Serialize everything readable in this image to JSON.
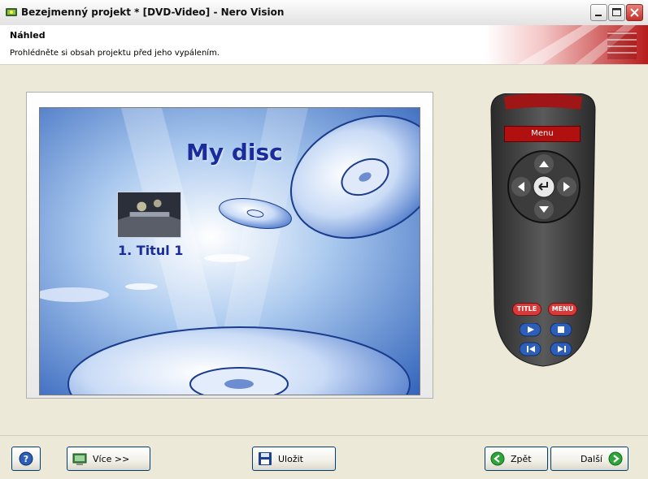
{
  "window": {
    "title": "Bezejmenný projekt * [DVD-Video] - Nero Vision",
    "controls": [
      "minimize-icon",
      "maximize-icon",
      "close-icon"
    ]
  },
  "header": {
    "title": "Náhled",
    "subtitle": "Prohlédněte si obsah projektu před jeho vypálením."
  },
  "preview": {
    "disc_title": "My disc",
    "titles": [
      {
        "label": "1. Titul 1"
      }
    ]
  },
  "remote": {
    "menu_label": "Menu",
    "buttons": {
      "title": "TITLE",
      "menu": "MENU"
    },
    "icons": [
      "up-arrow-icon",
      "down-arrow-icon",
      "left-arrow-icon",
      "right-arrow-icon",
      "enter-icon",
      "play-icon",
      "stop-icon",
      "previous-icon",
      "next-icon"
    ]
  },
  "footer": {
    "help_icon": "help-icon",
    "more_label": "Více >>",
    "save_label": "Uložit",
    "back_label": "Zpět",
    "next_label": "Další"
  },
  "colors": {
    "window_bg": "#ECE9D8",
    "disc_title": "#1A2C9C",
    "remote_body": "#3A3A3A",
    "remote_menu_bar": "#B01010",
    "remote_red_button": "#D83A3A",
    "remote_blue_button": "#2E5FB8",
    "nav_green": "#2FA43A"
  }
}
